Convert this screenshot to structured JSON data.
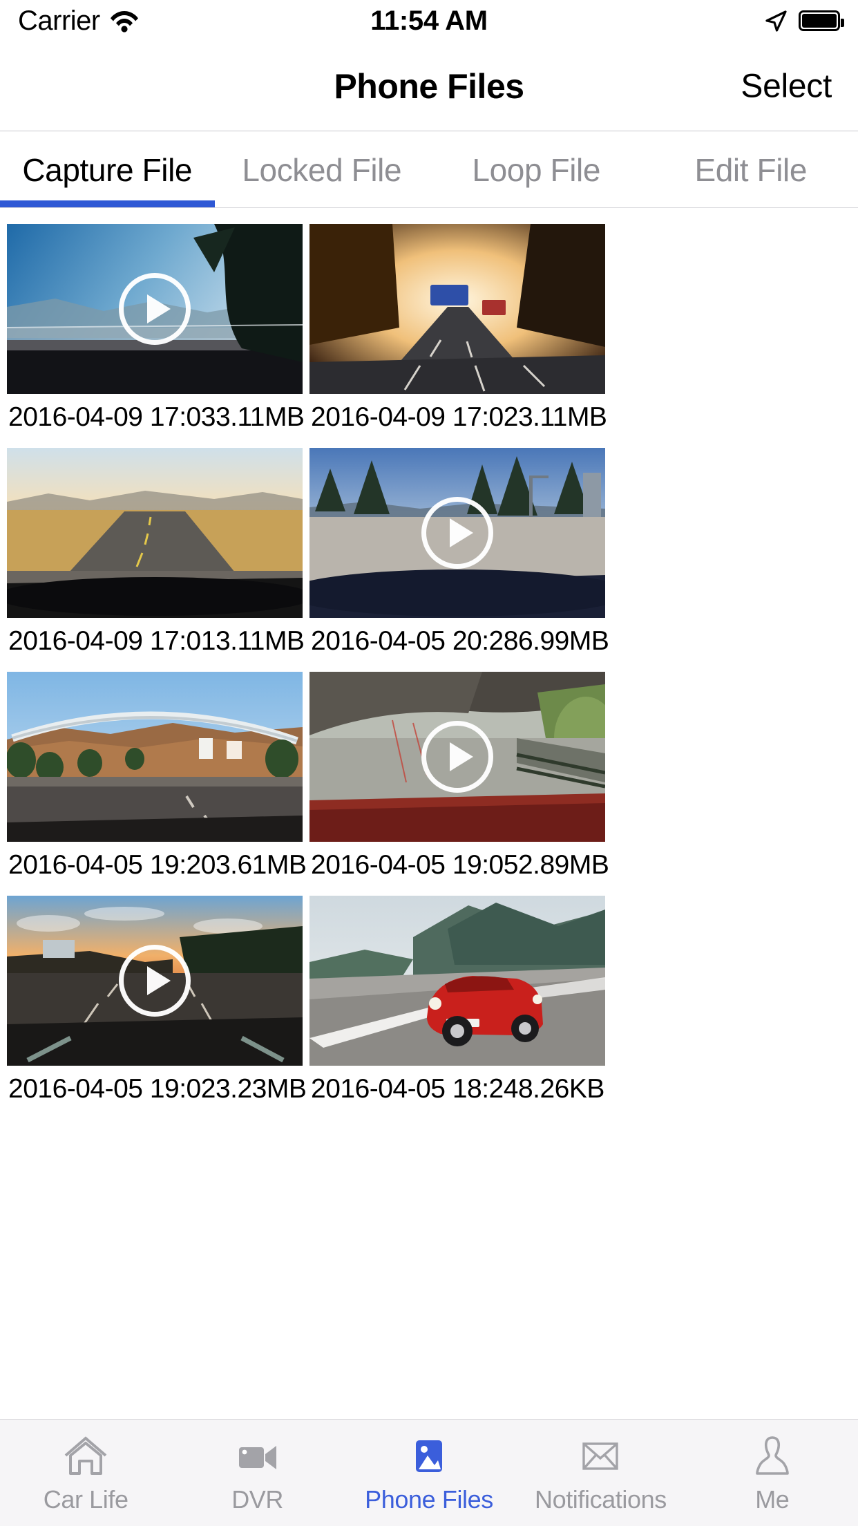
{
  "theme": {
    "accent": "#2e58d5",
    "tab_active": "#3b5edb",
    "tab_inactive": "#9a9a9f",
    "tabbar_bg": "#f6f5f7"
  },
  "status_bar": {
    "carrier": "Carrier",
    "time": "11:54 AM",
    "wifi_icon": "wifi-icon",
    "location_icon": "location-arrow-icon",
    "battery_icon": "battery-full-icon"
  },
  "nav_bar": {
    "title": "Phone Files",
    "right_action": "Select"
  },
  "segments": [
    {
      "label": "Capture File",
      "active": true
    },
    {
      "label": "Locked File",
      "active": false
    },
    {
      "label": "Loop File",
      "active": false
    },
    {
      "label": "Edit File",
      "active": false
    }
  ],
  "files": [
    {
      "date": "2016-04-09 17:03",
      "size": "3.11MB",
      "has_play": true
    },
    {
      "date": "2016-04-09 17:02",
      "size": "3.11MB",
      "has_play": false
    },
    {
      "date": "2016-04-09 17:01",
      "size": "3.11MB",
      "has_play": false
    },
    {
      "date": "2016-04-05 20:28",
      "size": "6.99MB",
      "has_play": true
    },
    {
      "date": "2016-04-05 19:20",
      "size": "3.61MB",
      "has_play": false
    },
    {
      "date": "2016-04-05 19:05",
      "size": "2.89MB",
      "has_play": true
    },
    {
      "date": "2016-04-05 19:02",
      "size": "3.23MB",
      "has_play": true
    },
    {
      "date": "2016-04-05 18:24",
      "size": "8.26KB",
      "has_play": false
    }
  ],
  "tab_bar": [
    {
      "label": "Car Life",
      "icon": "house-icon",
      "active": false
    },
    {
      "label": "DVR",
      "icon": "video-camera-icon",
      "active": false
    },
    {
      "label": "Phone Files",
      "icon": "photo-icon",
      "active": true
    },
    {
      "label": "Notifications",
      "icon": "envelope-icon",
      "active": false
    },
    {
      "label": "Me",
      "icon": "person-icon",
      "active": false
    }
  ]
}
